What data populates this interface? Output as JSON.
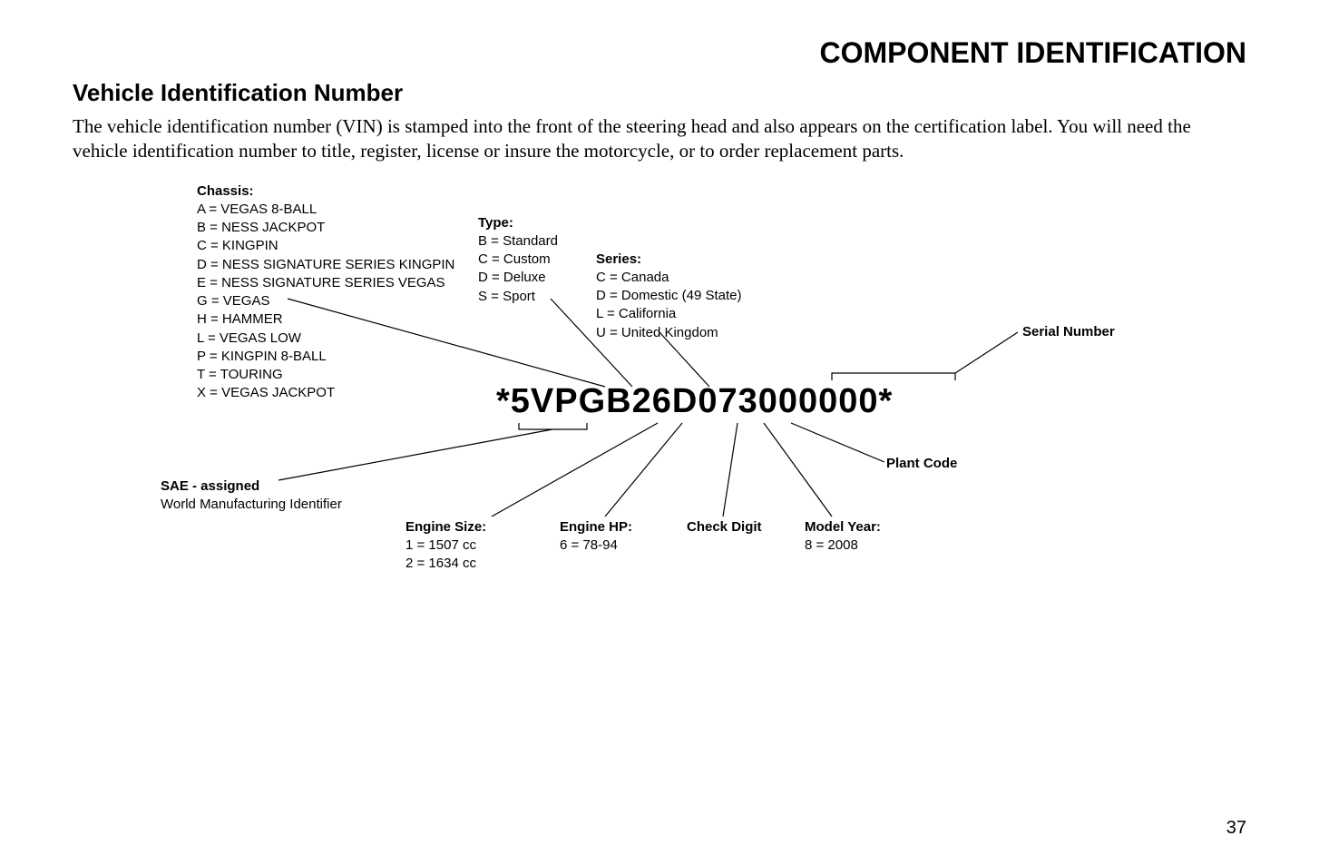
{
  "page_title": "COMPONENT IDENTIFICATION",
  "section_title": "Vehicle Identification Number",
  "intro": "The vehicle identification number (VIN) is stamped into the front of the steering head and also appears on the certification label. You will need the vehicle identification number to title, register, license or insure the motorcycle, or to order replacement parts.",
  "vin": "*5VPGB26D073000000*",
  "chassis": {
    "title": "Chassis:",
    "items": [
      "A  =  VEGAS 8-BALL",
      "B  =  NESS JACKPOT",
      "C  =  KINGPIN",
      "D  =  NESS SIGNATURE SERIES KINGPIN",
      "E  =  NESS SIGNATURE SERIES VEGAS",
      "G  =  VEGAS",
      "H  =  HAMMER",
      "L  =  VEGAS LOW",
      "P  =  KINGPIN 8-BALL",
      "T  =  TOURING",
      "X  =  VEGAS JACKPOT"
    ]
  },
  "type": {
    "title": "Type:",
    "items": [
      "B = Standard",
      "C = Custom",
      "D = Deluxe",
      "S = Sport"
    ]
  },
  "series": {
    "title": "Series:",
    "items": [
      "C  = Canada",
      "D  = Domestic (49 State)",
      "L  = California",
      "U  = United Kingdom"
    ]
  },
  "serial_number": "Serial Number",
  "plant_code": "Plant Code",
  "sae": {
    "title": "SAE - assigned",
    "sub": "World Manufacturing Identifier"
  },
  "engine_size": {
    "title": "Engine Size:",
    "items": [
      "1 = 1507 cc",
      "2 = 1634 cc"
    ]
  },
  "engine_hp": {
    "title": "Engine HP:",
    "items": [
      "6 = 78-94"
    ]
  },
  "check_digit": "Check Digit",
  "model_year": {
    "title": "Model Year:",
    "items": [
      "8 = 2008"
    ]
  },
  "page_number": "37",
  "chart_data": {
    "type": "diagram",
    "vin_example": "*5VPGB26D073000000*",
    "positions": [
      {
        "segment": "5VP",
        "label": "SAE - assigned World Manufacturing Identifier"
      },
      {
        "segment": "G",
        "label": "Chassis",
        "codes": {
          "A": "VEGAS 8-BALL",
          "B": "NESS JACKPOT",
          "C": "KINGPIN",
          "D": "NESS SIGNATURE SERIES KINGPIN",
          "E": "NESS SIGNATURE SERIES VEGAS",
          "G": "VEGAS",
          "H": "HAMMER",
          "L": "VEGAS LOW",
          "P": "KINGPIN 8-BALL",
          "T": "TOURING",
          "X": "VEGAS JACKPOT"
        }
      },
      {
        "segment": "B",
        "label": "Type",
        "codes": {
          "B": "Standard",
          "C": "Custom",
          "D": "Deluxe",
          "S": "Sport"
        }
      },
      {
        "segment": "2",
        "label": "Engine Size",
        "codes": {
          "1": "1507 cc",
          "2": "1634 cc"
        }
      },
      {
        "segment": "6",
        "label": "Engine HP",
        "codes": {
          "6": "78-94"
        }
      },
      {
        "segment": "D",
        "label": "Series",
        "codes": {
          "C": "Canada",
          "D": "Domestic (49 State)",
          "L": "California",
          "U": "United Kingdom"
        }
      },
      {
        "segment": "0",
        "label": "Check Digit"
      },
      {
        "segment": "7",
        "label": "Model Year",
        "codes": {
          "8": "2008"
        }
      },
      {
        "segment": "3",
        "label": "Plant Code"
      },
      {
        "segment": "000000",
        "label": "Serial Number"
      }
    ]
  }
}
